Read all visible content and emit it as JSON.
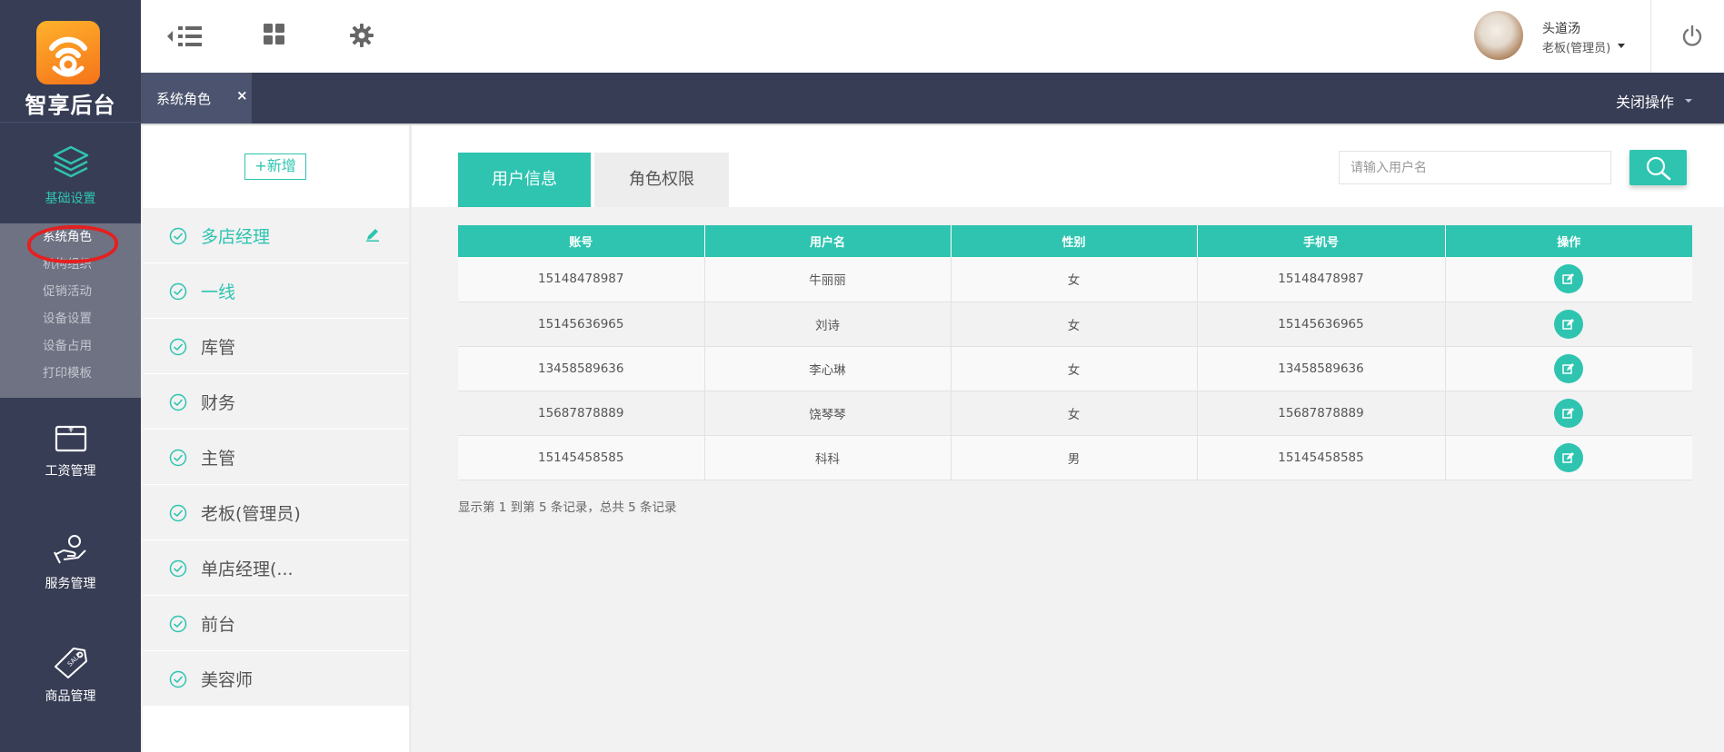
{
  "brand": {
    "name": "智享后台"
  },
  "sidebar": {
    "groups": [
      {
        "label": "基础设置",
        "icon": "layers-icon"
      },
      {
        "label": "工资管理",
        "icon": "salary-box-icon"
      },
      {
        "label": "服务管理",
        "icon": "hand-service-icon"
      },
      {
        "label": "商品管理",
        "icon": "sale-tag-icon"
      }
    ],
    "submenu": [
      "系统角色",
      "机构组织",
      "促销活动",
      "设备设置",
      "设备占用",
      "打印模板"
    ]
  },
  "header": {
    "user": {
      "name": "头道汤",
      "role": "老板(管理员)"
    }
  },
  "tabs": {
    "active_label": "系统角色",
    "close_symbol": "×",
    "close_ops": "关闭操作"
  },
  "roles": {
    "add_label": "+新增",
    "items": [
      "多店经理",
      "一线",
      "库管",
      "财务",
      "主管",
      "老板(管理员)",
      "单店经理(...",
      "前台",
      "美容师"
    ]
  },
  "content": {
    "tabs": [
      "用户信息",
      "角色权限"
    ],
    "search": {
      "placeholder": "请输入用户名"
    },
    "table": {
      "headers": [
        "账号",
        "用户名",
        "性别",
        "手机号",
        "操作"
      ],
      "rows": [
        [
          "15148478987",
          "牛丽丽",
          "女",
          "15148478987"
        ],
        [
          "15145636965",
          "刘诗",
          "女",
          "15145636965"
        ],
        [
          "13458589636",
          "李心琳",
          "女",
          "13458589636"
        ],
        [
          "15687878889",
          "饶琴琴",
          "女",
          "15687878889"
        ],
        [
          "15145458585",
          "科科",
          "男",
          "15145458585"
        ]
      ]
    },
    "footer": "显示第 1 到第 5 条记录，总共 5 条记录"
  },
  "colors": {
    "accent": "#2ec4b0",
    "sidebar": "#373d55",
    "logo": "#f5821f",
    "annotation": "#e42020"
  }
}
